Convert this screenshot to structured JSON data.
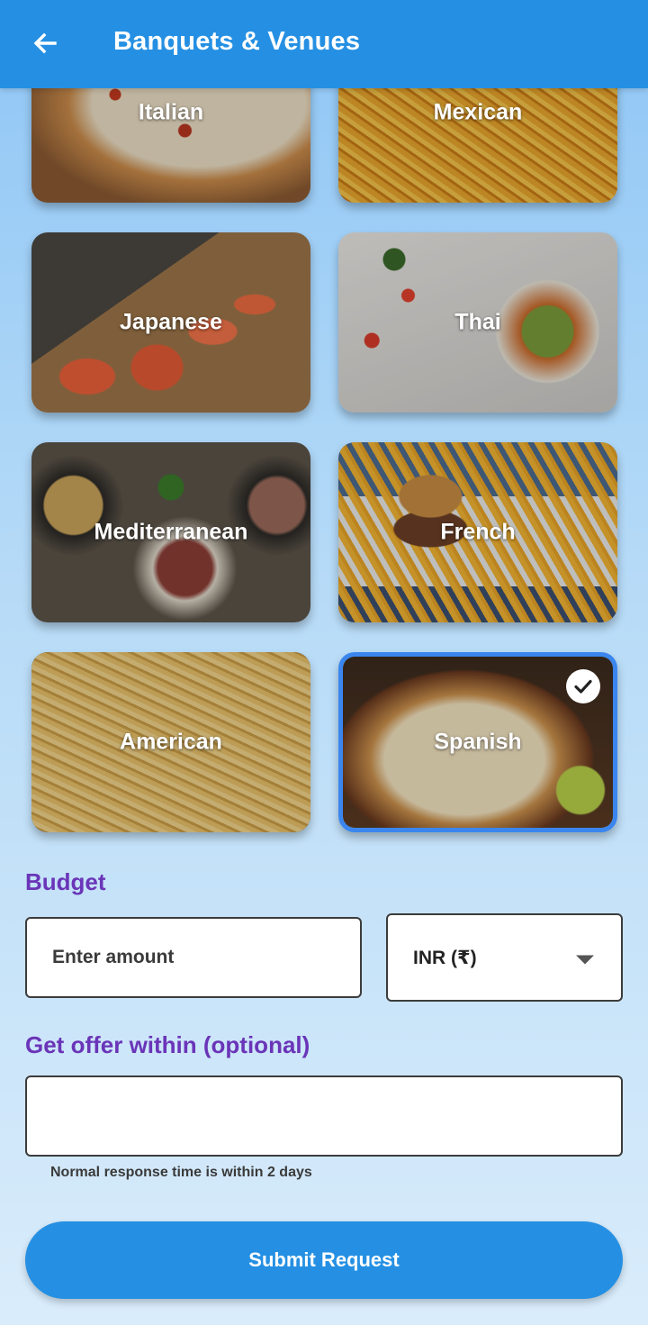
{
  "appbar": {
    "title": "Banquets & Venues",
    "back_icon": "arrow-left-icon",
    "color": "#2590e3"
  },
  "cuisines": [
    {
      "label": "Italian",
      "selected": false
    },
    {
      "label": "Mexican",
      "selected": false
    },
    {
      "label": "Japanese",
      "selected": false
    },
    {
      "label": "Thai",
      "selected": false
    },
    {
      "label": "Mediterranean",
      "selected": false
    },
    {
      "label": "French",
      "selected": false
    },
    {
      "label": "American",
      "selected": false
    },
    {
      "label": "Spanish",
      "selected": true
    }
  ],
  "budget": {
    "label": "Budget",
    "amount_placeholder": "Enter amount",
    "currency": "INR (₹)"
  },
  "offer": {
    "label": "Get offer within (optional)",
    "value": "",
    "helper": "Normal response time is within 2 days"
  },
  "submit_label": "Submit Request",
  "colors": {
    "accent": "#2590e3",
    "section_label": "#6a35b8",
    "selected_border": "#3a86ee"
  }
}
